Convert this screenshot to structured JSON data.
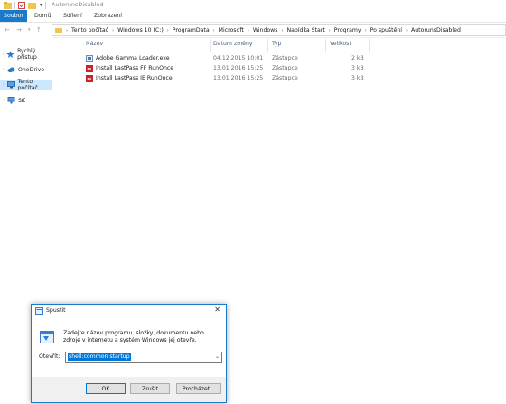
{
  "window": {
    "title": "AutorunsDisabled"
  },
  "ribbon": {
    "tabs": [
      {
        "label": "Soubor"
      },
      {
        "label": "Domů"
      },
      {
        "label": "Sdílení"
      },
      {
        "label": "Zobrazení"
      }
    ]
  },
  "address": {
    "crumbs": [
      "Tento počítač",
      "Windows 10 (C:)",
      "ProgramData",
      "Microsoft",
      "Windows",
      "Nabídka Start",
      "Programy",
      "Po spuštění",
      "AutorunsDisabled"
    ]
  },
  "sidebar": {
    "items": [
      {
        "label": "Rychlý přístup"
      },
      {
        "label": "OneDrive"
      },
      {
        "label": "Tento počítač"
      },
      {
        "label": "Síť"
      }
    ]
  },
  "columns": {
    "name": "Název",
    "date": "Datum změny",
    "type": "Typ",
    "size": "Velikost"
  },
  "files": [
    {
      "name": "Adobe Gamma Loader.exe",
      "date": "04.12.2015 10:01",
      "type": "Zástupce",
      "size": "2 kB"
    },
    {
      "name": "Install LastPass FF RunOnce",
      "date": "13.01.2016 15:25",
      "type": "Zástupce",
      "size": "3 kB"
    },
    {
      "name": "Install LastPass IE RunOnce",
      "date": "13.01.2016 15:25",
      "type": "Zástupce",
      "size": "3 kB"
    }
  ],
  "run_dialog": {
    "title": "Spustit",
    "description": "Zadejte název programu, složky, dokumentu nebo zdroje v internetu a systém Windows jej otevře.",
    "open_label": "Otevřít:",
    "input_value": "shell:common startup",
    "ok_label": "OK",
    "cancel_label": "Zrušit",
    "browse_label": "Procházet..."
  },
  "colors": {
    "accent": "#1979ca",
    "selection": "#cce8ff",
    "folder": "#f0c650"
  }
}
